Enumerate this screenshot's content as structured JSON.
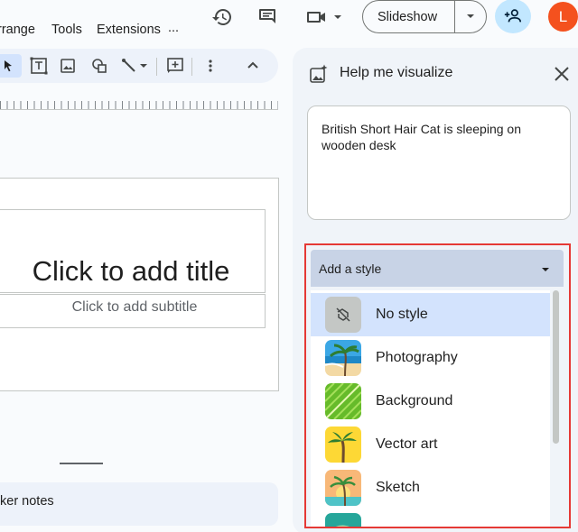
{
  "menu": {
    "arrange": "rrange",
    "tools": "Tools",
    "extensions": "Extensions",
    "more": "..."
  },
  "header": {
    "slideshow_label": "Slideshow",
    "avatar_initial": "L",
    "icons": [
      "history-icon",
      "comment-icon",
      "video-camera-icon",
      "add-person-icon"
    ]
  },
  "toolbar": {
    "icons": [
      "select-cursor-icon",
      "text-box-icon",
      "image-icon",
      "shape-icon",
      "line-icon",
      "chevron-down-icon",
      "new-comment-icon",
      "more-vert-icon",
      "chevron-up-icon"
    ]
  },
  "slide": {
    "title_placeholder": "Click to add title",
    "subtitle_placeholder": "Click to add subtitle"
  },
  "notes": {
    "label": "ker notes"
  },
  "panel": {
    "title": "Help me visualize",
    "prompt_text": "British Short Hair Cat is sleeping on wooden desk",
    "style_placeholder": "Add a style",
    "styles": [
      {
        "label": "No style",
        "selected": true,
        "icon": "no-style-icon"
      },
      {
        "label": "Photography",
        "selected": false,
        "icon": "beach-photo-thumb"
      },
      {
        "label": "Background",
        "selected": false,
        "icon": "leaf-thumb"
      },
      {
        "label": "Vector art",
        "selected": false,
        "icon": "palm-vector-thumb"
      },
      {
        "label": "Sketch",
        "selected": false,
        "icon": "palm-sketch-thumb"
      }
    ]
  },
  "colors": {
    "accent": "#0b57d0",
    "avatar": "#f4511e",
    "highlight": "#e53935",
    "selected": "#d3e3fd"
  }
}
